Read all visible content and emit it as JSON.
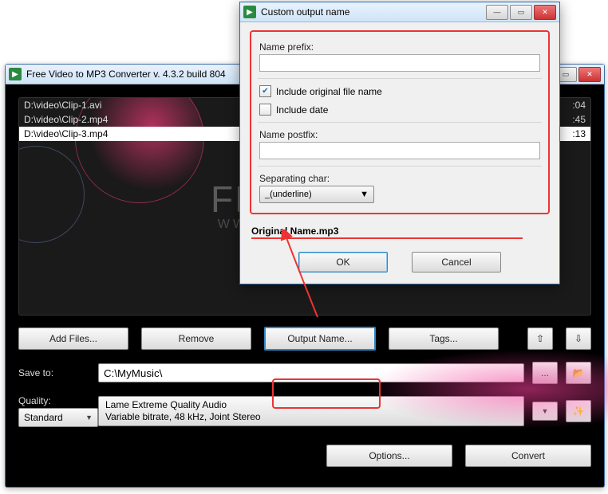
{
  "mainWindow": {
    "title": "Free Video to MP3 Converter  v. 4.3.2 build 804",
    "files": [
      {
        "path": "D:\\video\\Clip-1.avi",
        "time": ":04"
      },
      {
        "path": "D:\\video\\Clip-2.mp4",
        "time": ":45"
      },
      {
        "path": "D:\\video\\Clip-3.mp4",
        "time": ":13"
      }
    ],
    "watermark": {
      "big": "FRE",
      "small": "WWW.D"
    },
    "buttons": {
      "addFiles": "Add Files...",
      "remove": "Remove",
      "outputName": "Output Name...",
      "tags": "Tags...",
      "up": "⇧",
      "down": "⇩"
    },
    "saveToLabel": "Save to:",
    "saveToPath": "C:\\MyMusic\\",
    "browse": "...",
    "openFolder": "📂",
    "qualityLabel": "Quality:",
    "qualityPreset": "Standard",
    "qualityDesc1": "Lame Extreme Quality Audio",
    "qualityDesc2": "Variable bitrate, 48 kHz, Joint Stereo",
    "wand": "✨",
    "options": "Options...",
    "convert": "Convert"
  },
  "dialog": {
    "title": "Custom output name",
    "namePrefixLabel": "Name prefix:",
    "namePrefixValue": "",
    "includeOriginal": {
      "checked": true,
      "label": "Include original file name"
    },
    "includeDate": {
      "checked": false,
      "label": "Include date"
    },
    "namePostfixLabel": "Name postfix:",
    "namePostfixValue": "",
    "sepCharLabel": "Separating char:",
    "sepCharValue": "_(underline)",
    "preview": "Original Name.mp3",
    "ok": "OK",
    "cancel": "Cancel",
    "winBtns": {
      "min": "—",
      "max": "▭",
      "close": "✕"
    }
  }
}
